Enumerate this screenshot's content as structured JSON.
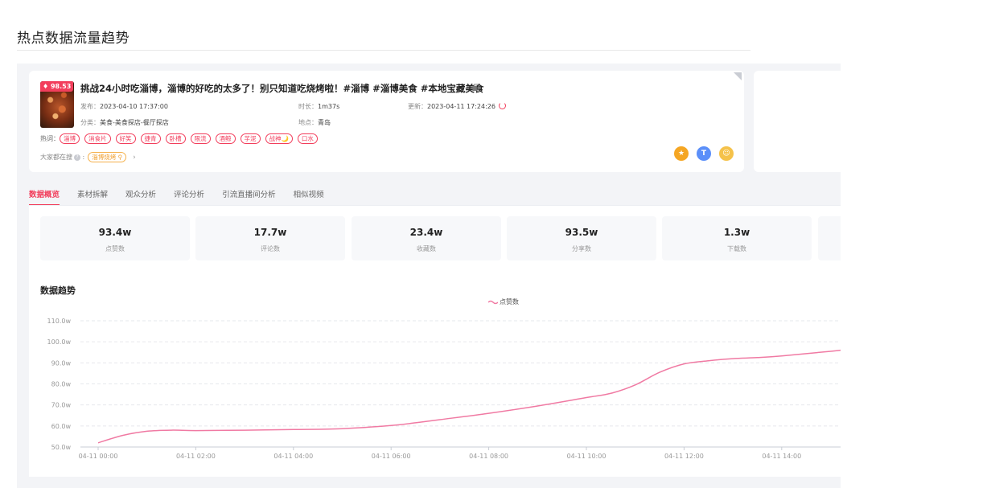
{
  "page": {
    "heading": "热点数据流量趋势"
  },
  "video": {
    "score": "98.53",
    "title": "挑战24小时吃淄博，淄博的好吃的太多了！别只知道吃烧烤啦！#淄博 #淄博美食 #本地宝藏美食",
    "publish_label": "发布：",
    "publish_time": "2023-04-10 17:37:00",
    "duration_label": "时长：",
    "duration": "1m37s",
    "update_label": "更新：",
    "update_time": "2023-04-11 17:24:26",
    "category_label": "分类：",
    "category": "美食-美食探店-餐厅探店",
    "location_label": "地点：",
    "location": "青岛",
    "hotwords_label": "热词：",
    "hotwords": [
      "淄博",
      "消食片",
      "好笑",
      "捷青",
      "卧槽",
      "限流",
      "酒鲸",
      "芋泥",
      "战神🌙",
      "口水"
    ],
    "search_label": "大家都在搜",
    "search_tag": "淄博烧烤"
  },
  "tabs": [
    "数据概览",
    "素材拆解",
    "观众分析",
    "评论分析",
    "引流直播间分析",
    "相似视频"
  ],
  "active_tab": "数据概览",
  "stats": [
    {
      "value": "93.4w",
      "label": "点赞数"
    },
    {
      "value": "17.7w",
      "label": "评论数"
    },
    {
      "value": "23.4w",
      "label": "收藏数"
    },
    {
      "value": "93.5w",
      "label": "分享数"
    },
    {
      "value": "1.3w",
      "label": "下载数"
    },
    {
      "value": "",
      "label": ""
    }
  ],
  "trend": {
    "title": "数据趋势"
  },
  "colors": {
    "accent": "#f23e5c",
    "line": "#f07aa3",
    "orange": "#f5a623",
    "blue": "#5b8ff9",
    "yellow": "#f5c24a"
  },
  "chart_data": {
    "type": "line",
    "legend": [
      "点赞数"
    ],
    "y_ticks": [
      "50.0w",
      "60.0w",
      "70.0w",
      "80.0w",
      "90.0w",
      "100.0w",
      "110.0w"
    ],
    "ylim": [
      50,
      110
    ],
    "x_ticks": [
      "04-11 00:00",
      "04-11 02:00",
      "04-11 04:00",
      "04-11 06:00",
      "04-11 08:00",
      "04-11 10:00",
      "04-11 12:00",
      "04-11 14:00"
    ],
    "grid": true,
    "series": [
      {
        "name": "点赞数",
        "x_hours": [
          0,
          0.5,
          1,
          1.5,
          2,
          3,
          4,
          5,
          6,
          6.5,
          7,
          8,
          9,
          10,
          10.5,
          11,
          11.5,
          12,
          12.5,
          13,
          13.5,
          14,
          15,
          15.5
        ],
        "values": [
          52,
          55.5,
          57.5,
          58,
          57.8,
          58,
          58.3,
          58.7,
          60.2,
          61.5,
          63,
          66,
          69.5,
          73.5,
          75.5,
          79.5,
          85.5,
          89.5,
          91,
          92,
          92.5,
          93.3,
          95.5,
          96.8
        ]
      }
    ]
  }
}
